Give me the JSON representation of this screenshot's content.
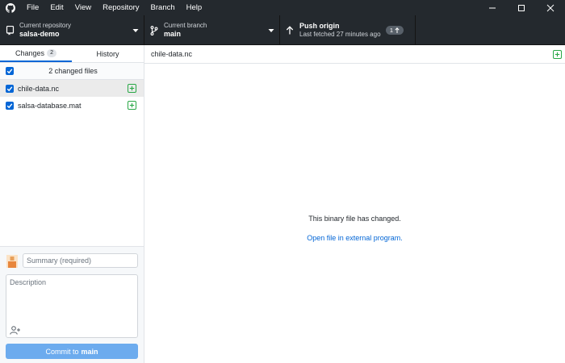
{
  "menu": {
    "items": [
      {
        "label": "File"
      },
      {
        "label": "Edit"
      },
      {
        "label": "View"
      },
      {
        "label": "Repository"
      },
      {
        "label": "Branch"
      },
      {
        "label": "Help"
      }
    ]
  },
  "toolbar": {
    "repository": {
      "caption": "Current repository",
      "value": "salsa-demo"
    },
    "branch": {
      "caption": "Current branch",
      "value": "main"
    },
    "push": {
      "title": "Push origin",
      "subtitle": "Last fetched 27 minutes ago",
      "ahead_count": "1"
    }
  },
  "sidebar": {
    "tabs": [
      {
        "label": "Changes",
        "count": "2"
      },
      {
        "label": "History"
      }
    ],
    "changed_files_label": "2 changed files",
    "files": [
      {
        "name": "chile-data.nc",
        "selected": true
      },
      {
        "name": "salsa-database.mat",
        "selected": false
      }
    ]
  },
  "commit": {
    "summary_placeholder": "Summary (required)",
    "description_placeholder": "Description",
    "button_prefix": "Commit to",
    "button_branch": "main"
  },
  "main": {
    "file_name": "chile-data.nc",
    "binary_message": "This binary file has changed.",
    "open_link": "Open file in external program."
  },
  "colors": {
    "titlebar_bg": "#24292e",
    "accent_blue": "#0366d6",
    "commit_button": "#6cabee",
    "added_green": "#28a745"
  }
}
